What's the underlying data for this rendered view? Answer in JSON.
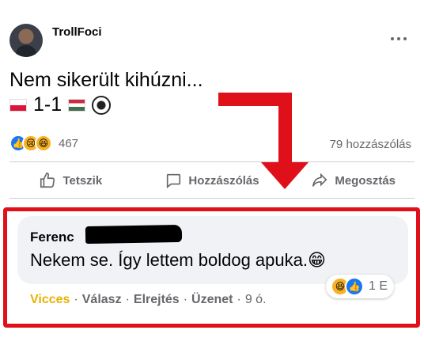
{
  "post": {
    "page_name": "TrollFoci",
    "text": "Nem sikerült kihúzni...",
    "score": "1-1",
    "reaction_count": "467",
    "comments_count": "79 hozzászólás",
    "actions": {
      "like": "Tetszik",
      "comment": "Hozzászólás",
      "share": "Megosztás"
    }
  },
  "comment": {
    "author": "Ferenc",
    "text": "Nekem se. Így lettem boldog apuka.😁",
    "reaction_count": "1 E",
    "actions": {
      "reaction": "Vicces",
      "reply": "Válasz",
      "hide": "Elrejtés",
      "message": "Üzenet",
      "time": "9 ó."
    }
  },
  "icons": [
    "more-icon",
    "like-icon",
    "comment-icon",
    "share-icon",
    "poland-flag-icon",
    "hungary-flag-icon",
    "football-icon"
  ],
  "colors": {
    "highlight": "#e0101a",
    "like_blue": "#1877f2",
    "vicces": "#e8b100"
  }
}
